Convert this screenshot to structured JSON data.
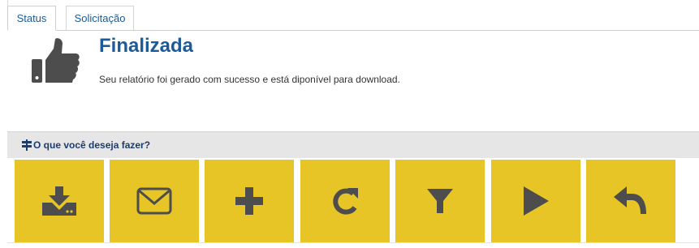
{
  "tabs": [
    {
      "label": "Status",
      "active": true
    },
    {
      "label": "Solicitação",
      "active": false
    }
  ],
  "status": {
    "icon": "thumbs-up-icon",
    "title": "Finalizada",
    "message": "Seu relatório foi gerado com sucesso e está diponível para download."
  },
  "actions_section": {
    "icon": "signpost-icon",
    "title": "O que você deseja fazer?"
  },
  "actions": [
    {
      "icon": "download-icon"
    },
    {
      "icon": "envelope-icon"
    },
    {
      "icon": "plus-icon"
    },
    {
      "icon": "refresh-icon"
    },
    {
      "icon": "filter-icon"
    },
    {
      "icon": "play-icon"
    },
    {
      "icon": "reply-icon"
    }
  ],
  "colors": {
    "accent_blue": "#1d5b98",
    "tab_text": "#1a5a96",
    "button_yellow": "#e8c527",
    "icon_gray": "#4d4d4d",
    "header_gray": "#e6e6e6"
  }
}
